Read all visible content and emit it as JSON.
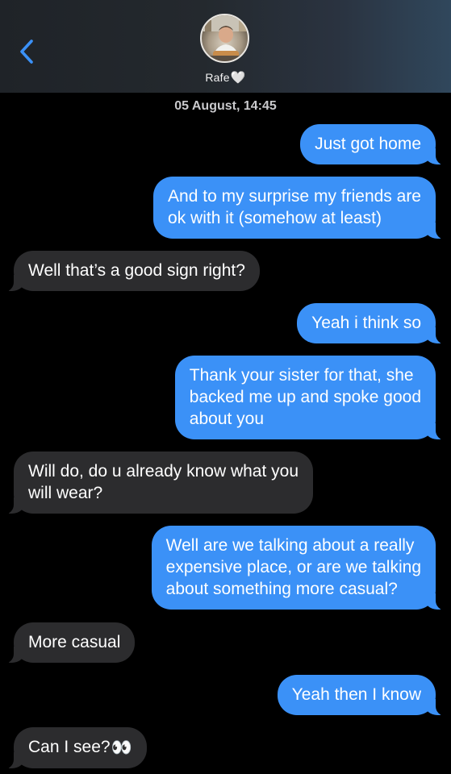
{
  "header": {
    "back_icon": "chevron-left-icon",
    "contact_name": "Rafe",
    "contact_emoji": "🤍"
  },
  "timestamp": "05 August, 14:45",
  "messages": [
    {
      "direction": "outgoing",
      "lines": [
        "Just got home"
      ]
    },
    {
      "direction": "outgoing",
      "lines": [
        "And to my surprise my friends are",
        "ok with it (somehow at least)"
      ]
    },
    {
      "direction": "incoming",
      "lines": [
        "Well that’s a good sign right?"
      ]
    },
    {
      "direction": "outgoing",
      "lines": [
        "Yeah i think so"
      ]
    },
    {
      "direction": "outgoing",
      "lines": [
        "Thank your sister for that, she",
        "backed me up and spoke good",
        "about you"
      ]
    },
    {
      "direction": "incoming",
      "lines": [
        "Will do, do u already know what you",
        "will wear?"
      ]
    },
    {
      "direction": "outgoing",
      "lines": [
        "Well are we talking about a really",
        "expensive place, or are we talking",
        "about something more casual?"
      ]
    },
    {
      "direction": "incoming",
      "lines": [
        "More casual"
      ]
    },
    {
      "direction": "outgoing",
      "lines": [
        "Yeah then I know"
      ]
    },
    {
      "direction": "incoming",
      "lines": [
        "Can I see?"
      ],
      "emoji": "👀"
    }
  ],
  "colors": {
    "outgoing_bubble": "#3b91f7",
    "incoming_bubble": "#2c2c2e",
    "accent": "#3b91f7",
    "background": "#000000"
  }
}
